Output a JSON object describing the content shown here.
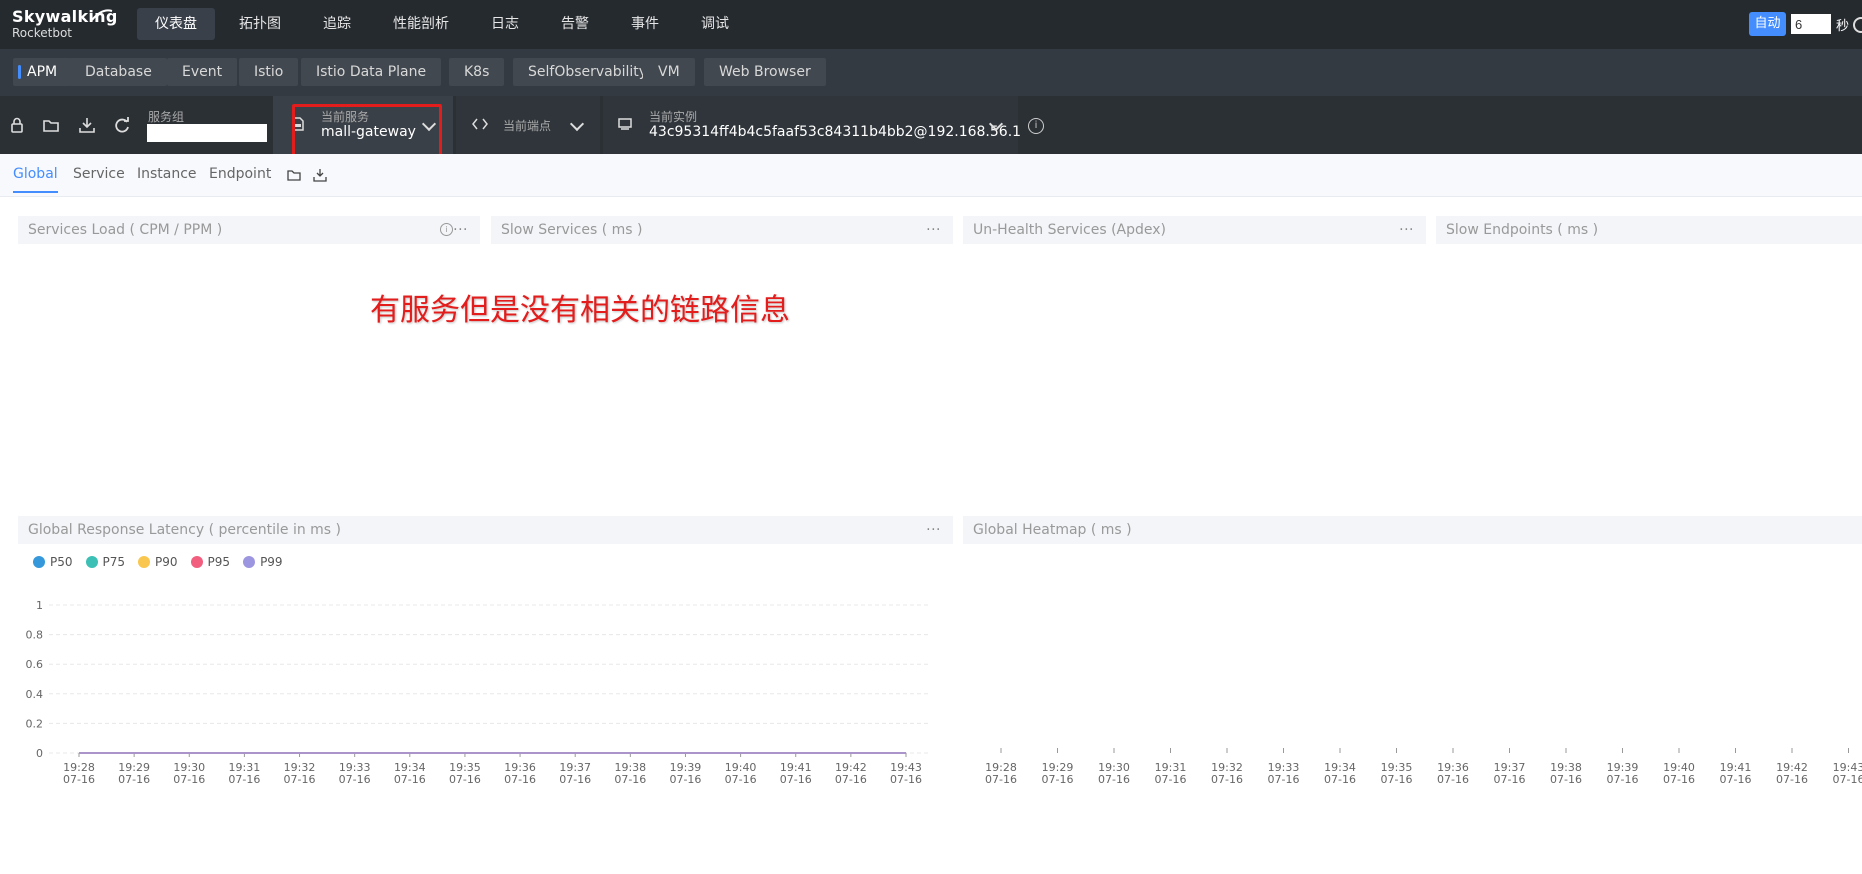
{
  "app": {
    "logo_line1": "Skywalking",
    "logo_line2": "Rocketbot"
  },
  "nav": {
    "items": [
      "仪表盘",
      "拓扑图",
      "追踪",
      "性能剖析",
      "日志",
      "告警",
      "事件",
      "调试"
    ],
    "active": "仪表盘",
    "auto_label": "自动",
    "interval_value": "6",
    "seconds_label": "秒"
  },
  "dashboard_tabs": {
    "items": [
      "APM",
      "Database",
      "Event",
      "Istio",
      "Istio Data Plane",
      "K8s",
      "SelfObservability",
      "VM",
      "Web Browser"
    ],
    "active": "APM"
  },
  "toolbar": {
    "group_label": "服务组",
    "group_value": "",
    "service_label": "当前服务",
    "service_value": "mall-gateway",
    "endpoint_label": "当前端点",
    "endpoint_value": "",
    "instance_label": "当前实例",
    "instance_value": "43c95314ff4b4c5faaf53c84311b4bb2@192.168.56.1"
  },
  "subtabs": {
    "items": [
      "Global",
      "Service",
      "Instance",
      "Endpoint"
    ],
    "active": "Global"
  },
  "panels": {
    "services_load": "Services Load ( CPM / PPM )",
    "slow_services": "Slow Services ( ms )",
    "unhealth_services": "Un-Health Services (Apdex)",
    "slow_endpoints": "Slow Endpoints ( ms )",
    "global_latency": "Global Response Latency ( percentile in ms )",
    "global_heatmap": "Global Heatmap ( ms )"
  },
  "annotation": "有服务但是没有相关的链路信息",
  "colors": {
    "accent": "#448dfe",
    "annotation_red": "#e31c1c"
  },
  "chart_data": [
    {
      "type": "line",
      "title": "Global Response Latency ( percentile in ms )",
      "legend_placement": "top-left",
      "series": [
        {
          "name": "P50",
          "color": "#3498db",
          "values": [
            0,
            0,
            0,
            0,
            0,
            0,
            0,
            0,
            0,
            0,
            0,
            0,
            0,
            0,
            0,
            0
          ]
        },
        {
          "name": "P75",
          "color": "#3cbfb4",
          "values": [
            0,
            0,
            0,
            0,
            0,
            0,
            0,
            0,
            0,
            0,
            0,
            0,
            0,
            0,
            0,
            0
          ]
        },
        {
          "name": "P90",
          "color": "#f9c74f",
          "values": [
            0,
            0,
            0,
            0,
            0,
            0,
            0,
            0,
            0,
            0,
            0,
            0,
            0,
            0,
            0,
            0
          ]
        },
        {
          "name": "P95",
          "color": "#f25f7e",
          "values": [
            0,
            0,
            0,
            0,
            0,
            0,
            0,
            0,
            0,
            0,
            0,
            0,
            0,
            0,
            0,
            0
          ]
        },
        {
          "name": "P99",
          "color": "#9c95e0",
          "values": [
            0,
            0,
            0,
            0,
            0,
            0,
            0,
            0,
            0,
            0,
            0,
            0,
            0,
            0,
            0,
            0
          ]
        }
      ],
      "x_times": [
        "19:28",
        "19:29",
        "19:30",
        "19:31",
        "19:32",
        "19:33",
        "19:34",
        "19:35",
        "19:36",
        "19:37",
        "19:38",
        "19:39",
        "19:40",
        "19:41",
        "19:42",
        "19:43"
      ],
      "x_date": "07-16",
      "yticks": [
        "0",
        "0.2",
        "0.4",
        "0.6",
        "0.8",
        "1"
      ],
      "ylim": [
        0,
        1
      ],
      "grid": true
    },
    {
      "type": "heatmap",
      "title": "Global Heatmap ( ms )",
      "x_times": [
        "19:28",
        "19:29",
        "19:30",
        "19:31",
        "19:32",
        "19:33",
        "19:34",
        "19:35",
        "19:36",
        "19:37",
        "19:38",
        "19:39",
        "19:40",
        "19:41",
        "19:42",
        "19:43"
      ],
      "x_date": "07-16",
      "values": []
    }
  ]
}
